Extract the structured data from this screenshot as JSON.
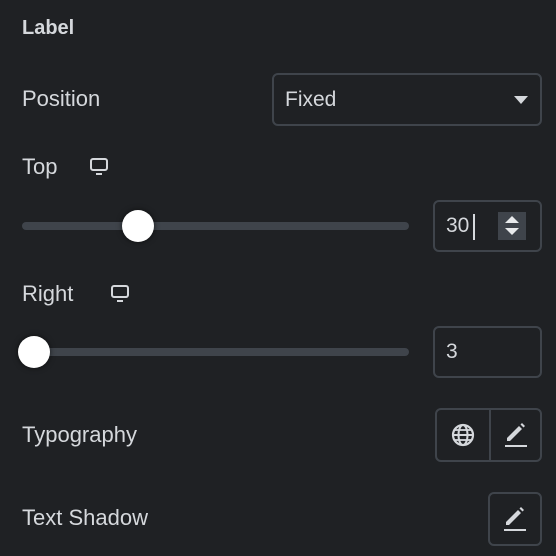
{
  "section_title": "Label",
  "position": {
    "label": "Position",
    "value": "Fixed"
  },
  "top": {
    "label": "Top",
    "value": "30",
    "slider_percent": 30,
    "device_icon": "desktop-icon"
  },
  "right": {
    "label": "Right",
    "value": "3",
    "slider_percent": 3,
    "device_icon": "desktop-icon"
  },
  "typography": {
    "label": "Typography",
    "icons": [
      "globe-icon",
      "pencil-icon"
    ]
  },
  "text_shadow": {
    "label": "Text Shadow",
    "icon": "pencil-icon"
  }
}
